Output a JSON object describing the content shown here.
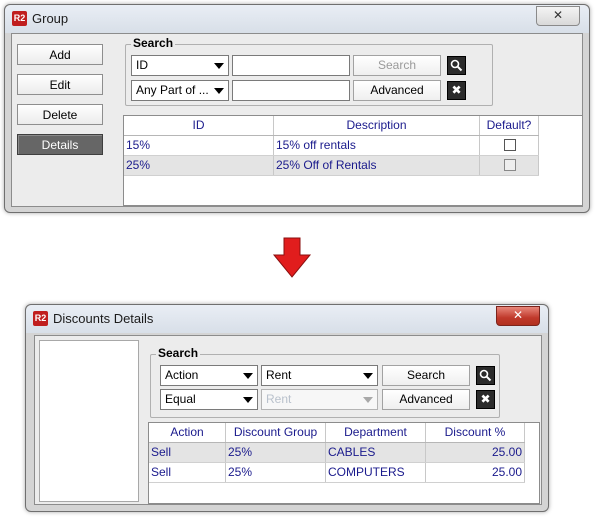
{
  "top_window": {
    "logo": "R2",
    "title": "Group",
    "buttons": {
      "add": "Add",
      "edit": "Edit",
      "delete": "Delete",
      "details": "Details"
    },
    "search": {
      "legend": "Search",
      "field": "ID",
      "match": "Any Part of ...",
      "search_label": "Search",
      "advanced_label": "Advanced"
    },
    "grid": {
      "columns": [
        "ID",
        "Description",
        "Default?"
      ],
      "rows": [
        {
          "id": "15%",
          "description": "15% off rentals"
        },
        {
          "id": "25%",
          "description": "25% Off of Rentals"
        }
      ]
    }
  },
  "bottom_window": {
    "logo": "R2",
    "title": "Discounts Details",
    "search": {
      "legend": "Search",
      "field": "Action",
      "value": "Rent",
      "operator": "Equal",
      "value2": "Rent",
      "search_label": "Search",
      "advanced_label": "Advanced"
    },
    "grid": {
      "columns": [
        "Action",
        "Discount Group",
        "Department",
        "Discount %"
      ],
      "rows": [
        {
          "action": "Sell",
          "group": "25%",
          "department": "CABLES",
          "discount": "25.00"
        },
        {
          "action": "Sell",
          "group": "25%",
          "department": "COMPUTERS",
          "discount": "25.00"
        }
      ]
    }
  },
  "colors": {
    "arrow": "#e11d1d",
    "close_red": "#c0392b",
    "grid_text": "#1a1a8c"
  }
}
